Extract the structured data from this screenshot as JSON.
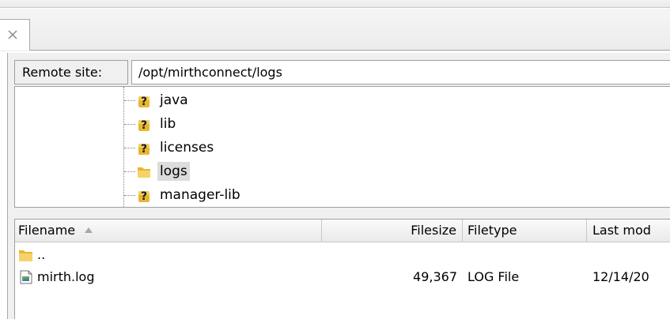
{
  "tab": {
    "close_glyph": "×"
  },
  "remote": {
    "label": "Remote site:",
    "path": "/opt/mirthconnect/logs"
  },
  "tree": {
    "items": [
      {
        "label": "java",
        "icon": "unknown-folder-icon",
        "selected": false
      },
      {
        "label": "lib",
        "icon": "unknown-folder-icon",
        "selected": false
      },
      {
        "label": "licenses",
        "icon": "unknown-folder-icon",
        "selected": false
      },
      {
        "label": "logs",
        "icon": "folder-icon",
        "selected": true
      },
      {
        "label": "manager-lib",
        "icon": "unknown-folder-icon",
        "selected": false
      }
    ]
  },
  "list": {
    "columns": {
      "filename": "Filename",
      "filesize": "Filesize",
      "filetype": "Filetype",
      "lastmod": "Last mod"
    },
    "rows": [
      {
        "name": "..",
        "size": "",
        "type": "",
        "modified": "",
        "icon": "folder-icon"
      },
      {
        "name": "mirth.log",
        "size": "49,367",
        "type": "LOG File",
        "modified": "12/14/20",
        "icon": "file-icon"
      }
    ]
  },
  "colors": {
    "folder": "#e8b730",
    "question": "#1a1a1a",
    "selection": "#dcdcdc",
    "border": "#a0a0a0"
  }
}
